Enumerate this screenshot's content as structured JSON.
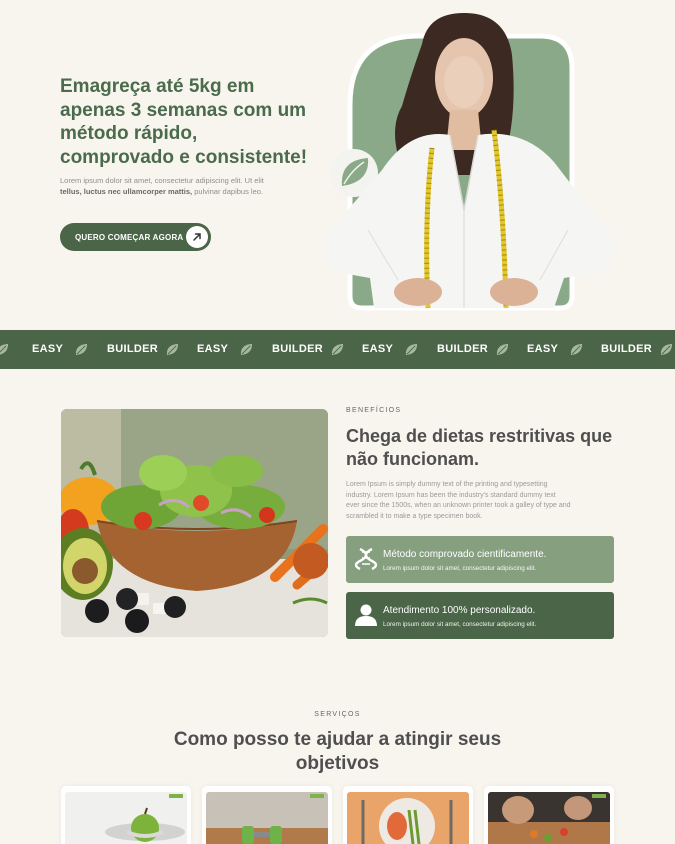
{
  "hero": {
    "title": "Emagreça até 5kg em apenas 3 semanas com um método rápido, comprovado e consistente!",
    "text_before": "Lorem ipsum dolor sit amet, consectetur adipiscing elit. Ut elit ",
    "text_bold": "tellus, luctus nec ullamcorper mattis,",
    "text_after": " pulvinar dapibus leo.",
    "cta_label": "QUERO COMEÇAR AGORA"
  },
  "band": {
    "items": [
      "EASY",
      "BUILDER",
      "EASY",
      "BUILDER",
      "EASY",
      "BUILDER",
      "EASY",
      "BUILDER"
    ]
  },
  "benefits": {
    "eyebrow": "BENEFÍCIOS",
    "title": "Chega de dietas restritivas que não funcionam.",
    "text": "Lorem Ipsum is simply dummy text of the printing and typesetting industry. Lorem Ipsum has been the industry's standard dummy text ever since the 1500s, when an unknown printer took a galley of type and scrambled it to make a type specimen book.",
    "features": [
      {
        "title": "Método comprovado cientificamente.",
        "subtitle": "Lorem ipsum dolor sit amet, consectetur adipiscing elit.",
        "icon": "dna-icon"
      },
      {
        "title": "Atendimento 100% personalizado.",
        "subtitle": "Lorem ipsum dolor sit amet, consectetur adipiscing elit.",
        "icon": "user-icon"
      }
    ]
  },
  "services": {
    "eyebrow": "SERVIÇOS",
    "title": "Como posso te ajudar a atingir seus objetivos"
  },
  "colors": {
    "brand_green": "#4a6547",
    "light_green": "#869f7f",
    "background": "#f8f5ef"
  }
}
